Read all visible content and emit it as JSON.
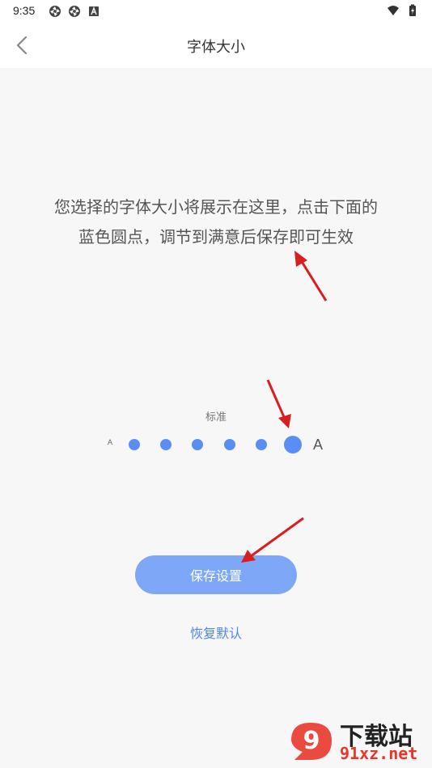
{
  "status_bar": {
    "time": "9:35",
    "left_icons": [
      "aperture-icon",
      "aperture-icon",
      "font-app-icon"
    ],
    "right_icons": [
      "wifi-icon",
      "battery-charging-icon"
    ]
  },
  "header": {
    "title": "字体大小",
    "back_icon": "chevron-left-icon"
  },
  "preview": {
    "line1": "您选择的字体大小将展示在这里，点击下面的",
    "line2": "蓝色圆点，调节到满意后保存即可生效"
  },
  "font_size": {
    "level_label": "标准",
    "small_marker": "A",
    "large_marker": "A",
    "steps": 6,
    "selected_index": 5,
    "dot_color": "#5b8ef5"
  },
  "actions": {
    "save_label": "保存设置",
    "reset_label": "恢复默认",
    "save_color": "#7ea7f8",
    "reset_color": "#4f86f0"
  },
  "watermark": {
    "line1": "下载站",
    "line2": "91xz.net",
    "logo_glyph": "9"
  },
  "annotations": {
    "arrow_color": "#d81e1e",
    "arrow_count": 3
  }
}
